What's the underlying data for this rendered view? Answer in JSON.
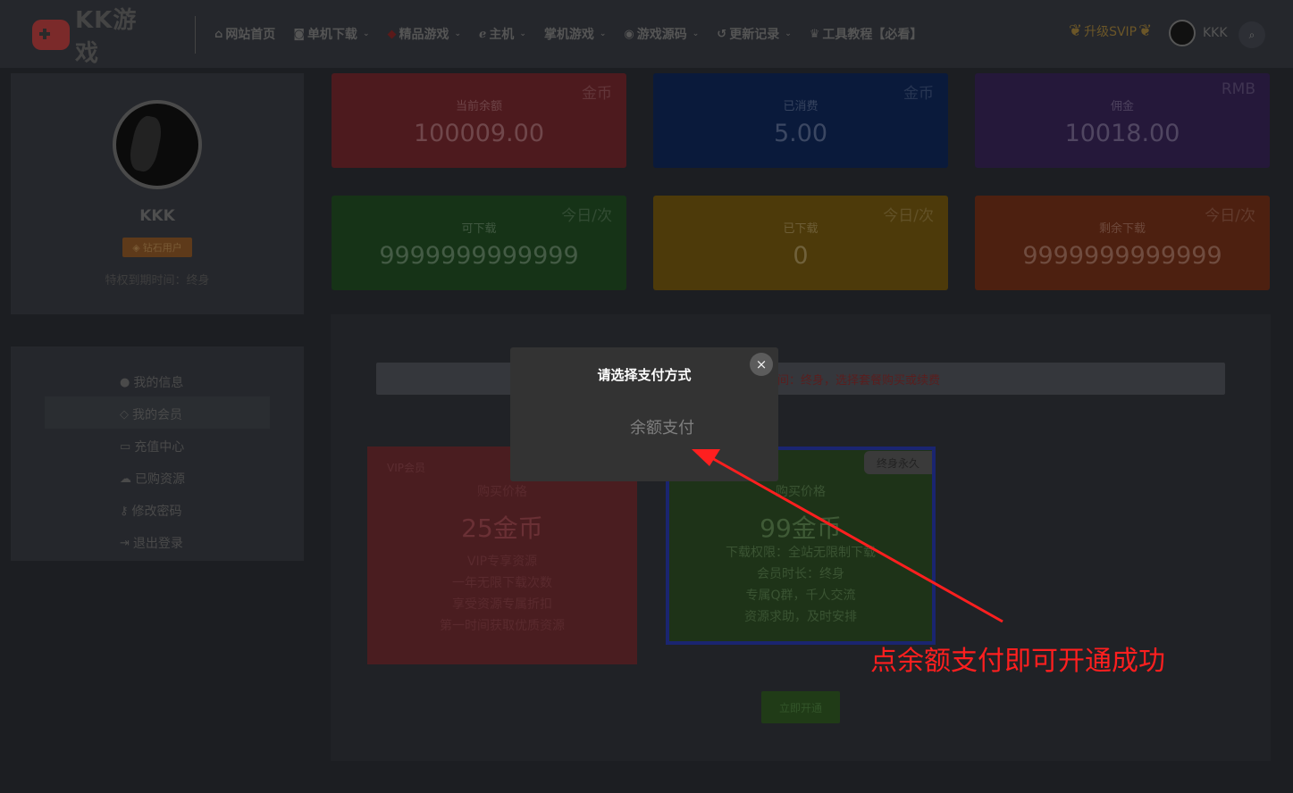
{
  "header": {
    "logo_text": "KK游戏",
    "nav": [
      {
        "icon": "home-icon",
        "glyph": "⌂",
        "label": "网站首页",
        "has_dropdown": false
      },
      {
        "icon": "gamepad-icon",
        "glyph": "◙",
        "label": "单机下载",
        "has_dropdown": true
      },
      {
        "icon": "diamond-icon",
        "glyph": "◆",
        "label": "精品游戏",
        "has_dropdown": true
      },
      {
        "icon": "e-icon",
        "glyph": "ℯ",
        "label": "主机",
        "has_dropdown": true
      },
      {
        "icon": "",
        "glyph": "",
        "label": "掌机游戏",
        "has_dropdown": true
      },
      {
        "icon": "dribbble-icon",
        "glyph": "◉",
        "label": "游戏源码",
        "has_dropdown": true
      },
      {
        "icon": "history-icon",
        "glyph": "↺",
        "label": "更新记录",
        "has_dropdown": true
      },
      {
        "icon": "crown-icon",
        "glyph": "♛",
        "label": "工具教程【必看】",
        "has_dropdown": false
      }
    ],
    "svip_label": "升级SVIP",
    "username": "KKK"
  },
  "profile": {
    "name": "KKK",
    "badge": "钻石用户",
    "expire": "特权到期时间：终身"
  },
  "menu": [
    {
      "icon": "user-icon",
      "glyph": "👤",
      "label": "我的信息"
    },
    {
      "icon": "diamond-icon",
      "glyph": "◇",
      "label": "我的会员"
    },
    {
      "icon": "card-icon",
      "glyph": "▭",
      "label": "充值中心"
    },
    {
      "icon": "cloud-icon",
      "glyph": "☁",
      "label": "已购资源"
    },
    {
      "icon": "key-icon",
      "glyph": "⚷",
      "label": "修改密码"
    },
    {
      "icon": "signout-icon",
      "glyph": "⇥",
      "label": "退出登录"
    }
  ],
  "stats": [
    {
      "unit": "金币",
      "label": "当前余额",
      "value": "100009.00",
      "color": "#4d1a1e"
    },
    {
      "unit": "金币",
      "label": "已消费",
      "value": "5.00",
      "color": "#0a1a3b"
    },
    {
      "unit": "RMB",
      "label": "佣金",
      "value": "10018.00",
      "color": "#25183a"
    },
    {
      "unit": "今日/次",
      "label": "可下载",
      "value": "9999999999999",
      "color": "#163317"
    },
    {
      "unit": "今日/次",
      "label": "已下载",
      "value": "0",
      "color": "#4d3a0a"
    },
    {
      "unit": "今日/次",
      "label": "剩余下载",
      "value": "9999999999999",
      "color": "#4d2010"
    }
  ],
  "info_bar": {
    "text": "间：终身，选择套餐购买或续费"
  },
  "plans": {
    "red": {
      "tag": "VIP会员",
      "price_label": "购买价格",
      "price": "25金币",
      "features": [
        "VIP专享资源",
        "一年无限下载次数",
        "享受资源专属折扣",
        "第一时间获取优质资源"
      ]
    },
    "green": {
      "ribbon": "终身永久",
      "price_label": "购买价格",
      "price": "99金币",
      "features": [
        "下载权限：全站无限制下载",
        "会员时长：终身",
        "专属Q群，千人交流",
        "资源求助，及时安排"
      ]
    }
  },
  "open_button": "立即开通",
  "modal": {
    "title": "请选择支付方式",
    "close": "×",
    "option": "余额支付"
  },
  "annotation": {
    "text": "点余额支付即可开通成功",
    "color": "#ff1f1f"
  }
}
